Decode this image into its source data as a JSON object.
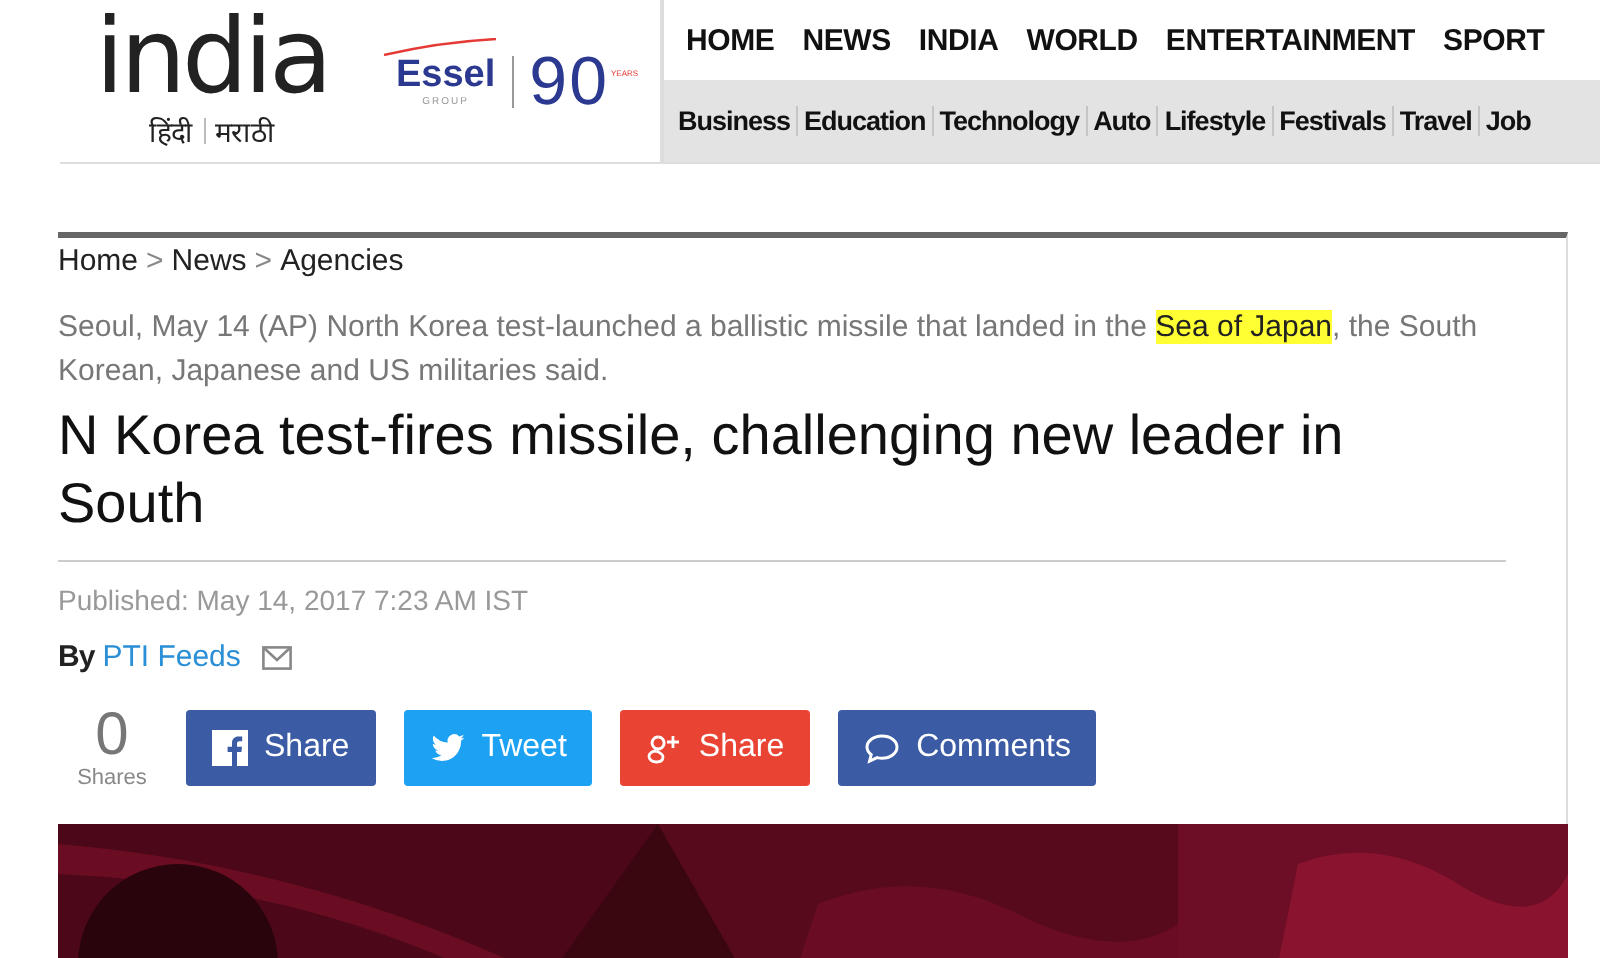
{
  "logo": {
    "name": "india",
    "languages": [
      "हिंदी",
      "मराठी"
    ]
  },
  "partner": {
    "name": "Essel",
    "group": "GROUP",
    "years": "90",
    "years_label": "YEARS"
  },
  "main_nav": [
    "HOME",
    "NEWS",
    "INDIA",
    "WORLD",
    "ENTERTAINMENT",
    "SPORT"
  ],
  "sub_nav": [
    "Business",
    "Education",
    "Technology",
    "Auto",
    "Lifestyle",
    "Festivals",
    "Travel",
    "Job"
  ],
  "breadcrumb": {
    "items": [
      "Home",
      "News",
      "Agencies"
    ],
    "separator": ">"
  },
  "summary": {
    "before": "Seoul, May 14 (AP) North Korea test-launched a ballistic missile that landed in the ",
    "highlight": "Sea of Japan",
    "after": ", the South Korean, Japanese and US militaries said."
  },
  "title": "N Korea test-fires missile, challenging new leader in South",
  "published": "Published: May 14, 2017 7:23 AM IST",
  "byline": {
    "prefix": "By",
    "author": "PTI Feeds"
  },
  "shares": {
    "count": "0",
    "label": "Shares"
  },
  "share_buttons": [
    {
      "kind": "facebook",
      "label": "Share"
    },
    {
      "kind": "twitter",
      "label": "Tweet"
    },
    {
      "kind": "googleplus",
      "label": "Share"
    },
    {
      "kind": "comments",
      "label": "Comments"
    }
  ]
}
